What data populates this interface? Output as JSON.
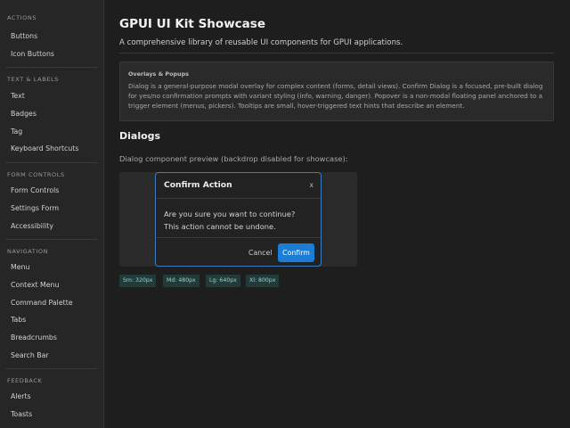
{
  "sidebar": {
    "sections": [
      {
        "heading": "ACTIONS",
        "items": [
          "Buttons",
          "Icon Buttons"
        ]
      },
      {
        "heading": "TEXT & LABELS",
        "items": [
          "Text",
          "Badges",
          "Tag",
          "Keyboard Shortcuts"
        ]
      },
      {
        "heading": "FORM CONTROLS",
        "items": [
          "Form Controls",
          "Settings Form",
          "Accessibility"
        ]
      },
      {
        "heading": "NAVIGATION",
        "items": [
          "Menu",
          "Context Menu",
          "Command Palette",
          "Tabs",
          "Breadcrumbs",
          "Search Bar"
        ]
      },
      {
        "heading": "FEEDBACK",
        "items": [
          "Alerts",
          "Toasts"
        ]
      }
    ]
  },
  "main": {
    "title": "GPUI UI Kit Showcase",
    "subtitle": "A comprehensive library of reusable UI components for GPUI applications.",
    "info": {
      "title": "Overlays & Popups",
      "text": "Dialog is a general-purpose modal overlay for complex content (forms, detail views). Confirm Dialog is a focused, pre-built dialog for yes/no confirmation prompts with variant styling (info, warning, danger). Popover is a non-modal floating panel anchored to a trigger element (menus, pickers). Tooltips are small, hover-triggered text hints that describe an element."
    },
    "section_title": "Dialogs",
    "section_desc": "Dialog component preview (backdrop disabled for showcase):",
    "dialog": {
      "title": "Confirm Action",
      "close": "x",
      "body": "Are you sure you want to continue? This action cannot be undone.",
      "cancel": "Cancel",
      "confirm": "Confirm"
    },
    "sizes": [
      "Sm: 320px",
      "Md: 480px",
      "Lg: 640px",
      "Xl: 800px"
    ]
  },
  "colors": {
    "accent": "#1a7dd6",
    "dialog_border": "#3b7bc0",
    "chip_bg": "#213b3a",
    "chip_text": "#9bd1cb"
  }
}
